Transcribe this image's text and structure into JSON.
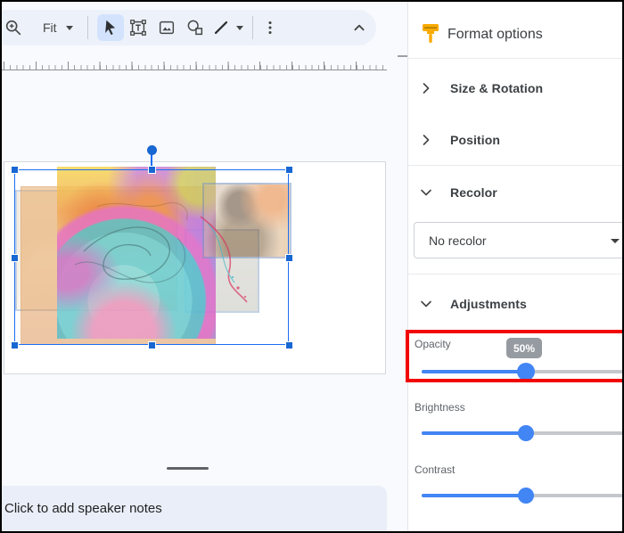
{
  "toolbar": {
    "fit_label": "Fit",
    "icons": [
      "zoom-in-icon",
      "fit-caret-icon",
      "select-tool-icon",
      "text-box-icon",
      "insert-image-icon",
      "insert-shape-icon",
      "insert-line-icon",
      "line-caret-icon",
      "more-options-icon",
      "collapse-toolbar-icon"
    ]
  },
  "panel": {
    "title": "Format options",
    "header_icon": "paint-brush-icon",
    "sections": {
      "size_rotation": {
        "label": "Size & Rotation",
        "state": "collapsed"
      },
      "position": {
        "label": "Position",
        "state": "collapsed"
      },
      "recolor": {
        "label": "Recolor",
        "state": "expanded",
        "dropdown_value": "No recolor"
      },
      "adjustments": {
        "label": "Adjustments",
        "state": "expanded"
      }
    },
    "sliders": {
      "opacity": {
        "label": "Opacity",
        "percent": 50,
        "tooltip": "50%",
        "highlighted": true
      },
      "brightness": {
        "label": "Brightness",
        "percent": 50
      },
      "contrast": {
        "label": "Contrast",
        "percent": 50
      }
    }
  },
  "notes": {
    "placeholder": "Click to add speaker notes"
  },
  "colors": {
    "accent_blue": "#4285f4",
    "selection_blue": "#1967d2",
    "highlight_red": "#f20505",
    "tooltip_gray": "#969ba1",
    "brush_yellow": "#f9ab00",
    "toolbar_bg": "#edf2fa",
    "canvas_bg": "#f8fafd",
    "notes_bg": "#e9eef8"
  }
}
